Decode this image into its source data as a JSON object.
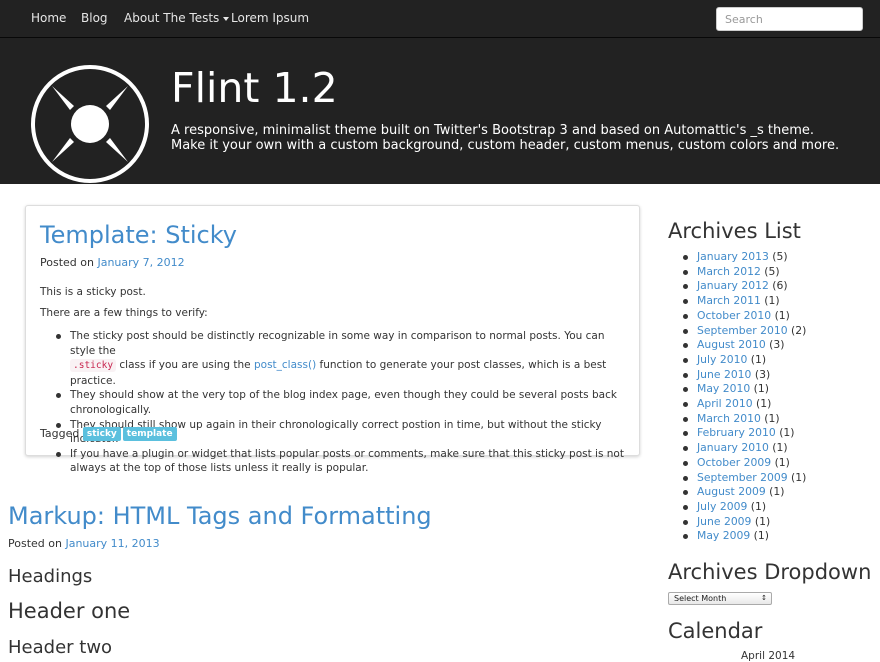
{
  "nav": {
    "items": [
      "Home",
      "Blog",
      "About The Tests",
      "Lorem Ipsum"
    ],
    "search_placeholder": "Search"
  },
  "header": {
    "title": "Flint 1.2",
    "tagline": "A responsive, minimalist theme built on Twitter's Bootstrap 3 and based on Automattic's _s theme. Make it your own with a custom background, custom header, custom menus, custom colors and more."
  },
  "sticky_post": {
    "title": "Template: Sticky",
    "posted_on": "Posted on",
    "date": "January 7, 2012",
    "para1": "This is a sticky post.",
    "para2": "There are a few things to verify:",
    "bullet1_a": "The sticky post should be distinctly recognizable in some way in comparison to normal posts. You can style the",
    "bullet1_code": ".sticky",
    "bullet1_b": "class if you are using the",
    "bullet1_link": "post_class()",
    "bullet1_c": "function to generate your post classes, which is a best practice.",
    "bullet2": "They should show at the very top of the blog index page, even though they could be several posts back chronologically.",
    "bullet3": "They should still show up again in their chronologically correct postion in time, but without the sticky indicator.",
    "bullet4": "If you have a plugin or widget that lists popular posts or comments, make sure that this sticky post is not always at the top of those lists unless it really is popular.",
    "tagged_label": "Tagged",
    "tags": [
      "sticky",
      "template"
    ]
  },
  "markup_post": {
    "title": "Markup: HTML Tags and Formatting",
    "posted_on": "Posted on",
    "date": "January 11, 2013",
    "headings": "Headings",
    "h1": "Header one",
    "h2": "Header two"
  },
  "sidebar": {
    "archives_title": "Archives List",
    "archives": [
      {
        "month": "January 2013",
        "count": "(5)"
      },
      {
        "month": "March 2012",
        "count": "(5)"
      },
      {
        "month": "January 2012",
        "count": "(6)"
      },
      {
        "month": "March 2011",
        "count": "(1)"
      },
      {
        "month": "October 2010",
        "count": "(1)"
      },
      {
        "month": "September 2010",
        "count": "(2)"
      },
      {
        "month": "August 2010",
        "count": "(3)"
      },
      {
        "month": "July 2010",
        "count": "(1)"
      },
      {
        "month": "June 2010",
        "count": "(3)"
      },
      {
        "month": "May 2010",
        "count": "(1)"
      },
      {
        "month": "April 2010",
        "count": "(1)"
      },
      {
        "month": "March 2010",
        "count": "(1)"
      },
      {
        "month": "February 2010",
        "count": "(1)"
      },
      {
        "month": "January 2010",
        "count": "(1)"
      },
      {
        "month": "October 2009",
        "count": "(1)"
      },
      {
        "month": "September 2009",
        "count": "(1)"
      },
      {
        "month": "August 2009",
        "count": "(1)"
      },
      {
        "month": "July 2009",
        "count": "(1)"
      },
      {
        "month": "June 2009",
        "count": "(1)"
      },
      {
        "month": "May 2009",
        "count": "(1)"
      }
    ],
    "dropdown_title": "Archives Dropdown",
    "dropdown_value": "Select Month",
    "calendar_title": "Calendar",
    "calendar_caption": "April 2014"
  },
  "colors": {
    "accent": "#428bca",
    "navbar": "#222222",
    "tag": "#5bc0de"
  }
}
